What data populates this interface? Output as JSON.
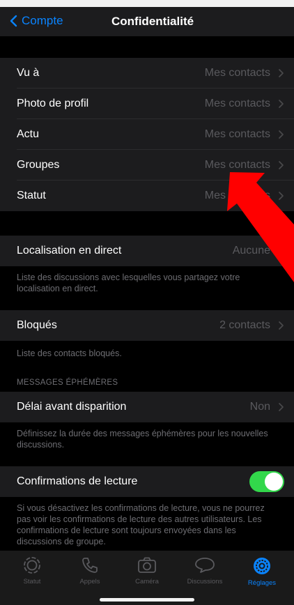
{
  "nav": {
    "back_label": "Compte",
    "title": "Confidentialité"
  },
  "privacy_rows": [
    {
      "label": "Vu à",
      "value": "Mes contacts"
    },
    {
      "label": "Photo de profil",
      "value": "Mes contacts"
    },
    {
      "label": "Actu",
      "value": "Mes contacts"
    },
    {
      "label": "Groupes",
      "value": "Mes contacts"
    },
    {
      "label": "Statut",
      "value": "Mes contacts"
    }
  ],
  "live_location": {
    "label": "Localisation en direct",
    "value": "Aucune",
    "footer": "Liste des discussions avec lesquelles vous partagez votre localisation en direct."
  },
  "blocked": {
    "label": "Bloqués",
    "value": "2 contacts",
    "footer": "Liste des contacts bloqués."
  },
  "ephemeral": {
    "header": "MESSAGES ÉPHÉMÈRES",
    "label": "Délai avant disparition",
    "value": "Non",
    "footer": "Définissez la durée des messages éphémères pour les nouvelles discussions."
  },
  "read_receipts": {
    "label": "Confirmations de lecture",
    "enabled": true,
    "footer": "Si vous désactivez les confirmations de lecture, vous ne pourrez pas voir les confirmations de lecture des autres utilisateurs. Les confirmations de lecture sont toujours envoyées dans les discussions de groupe."
  },
  "tabbar": {
    "tabs": [
      {
        "label": "Statut",
        "icon": "status-icon"
      },
      {
        "label": "Appels",
        "icon": "phone-icon"
      },
      {
        "label": "Caméra",
        "icon": "camera-icon"
      },
      {
        "label": "Discussions",
        "icon": "chat-bubbles-icon"
      },
      {
        "label": "Réglages",
        "icon": "settings-gear-icon",
        "active": true
      }
    ]
  },
  "colors": {
    "accent": "#0a84ff",
    "toggle_on": "#32d74b",
    "annotation_arrow": "#ff0000",
    "background": "#000000",
    "cell": "#1c1c1e"
  }
}
